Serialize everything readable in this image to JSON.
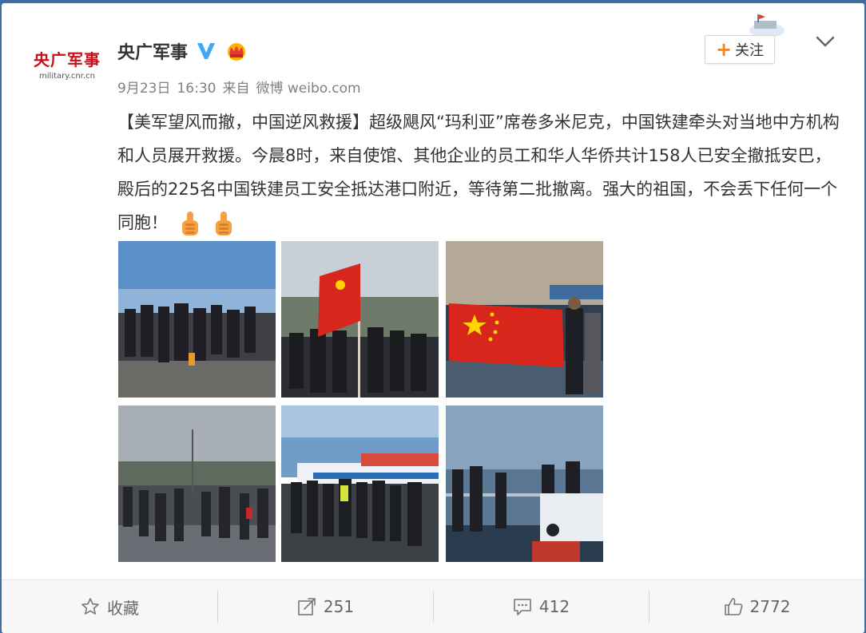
{
  "account": {
    "avatar_text": "央广军事",
    "avatar_sub": "military.cnr.cn",
    "name": "央广军事",
    "verified_icon": "verified-v-icon",
    "member_icon": "crown-icon"
  },
  "meta": {
    "date": "9月23日",
    "time": "16:30",
    "source_prefix": "来自",
    "source": "微博 weibo.com"
  },
  "follow": {
    "plus": "+",
    "label": "关注"
  },
  "post": {
    "text": "【美军望风而撤，中国逆风救援】超级飓风“玛利亚”席卷多米尼克，中国铁建牵头对当地中方机构和人员展开救援。今晨8时，来自使馆、其他企业的员工和华人华侨共计158人已安全撤抵安巴，殿后的225名中国铁建员工安全抵达港口附近，等待第二批撤离。强大的祖国，不会丢下任何一个同胞！",
    "emoji": [
      "thumbs-up-icon",
      "thumbs-up-icon"
    ]
  },
  "photos": [
    "crowd at pier under blue sky",
    "group holding chinese flag",
    "person holding chinese flag on ship",
    "crowd on wet road under cloudy sky",
    "crowd boarding ferry",
    "people on ship deck"
  ],
  "footer": {
    "favorite_label": "收藏",
    "repost_count": "251",
    "comment_count": "412",
    "like_count": "2772"
  },
  "colors": {
    "accent": "#ff8200",
    "verified": "#3fa9f5",
    "brand_red": "#c9101a",
    "background": "#3f6fa0"
  }
}
